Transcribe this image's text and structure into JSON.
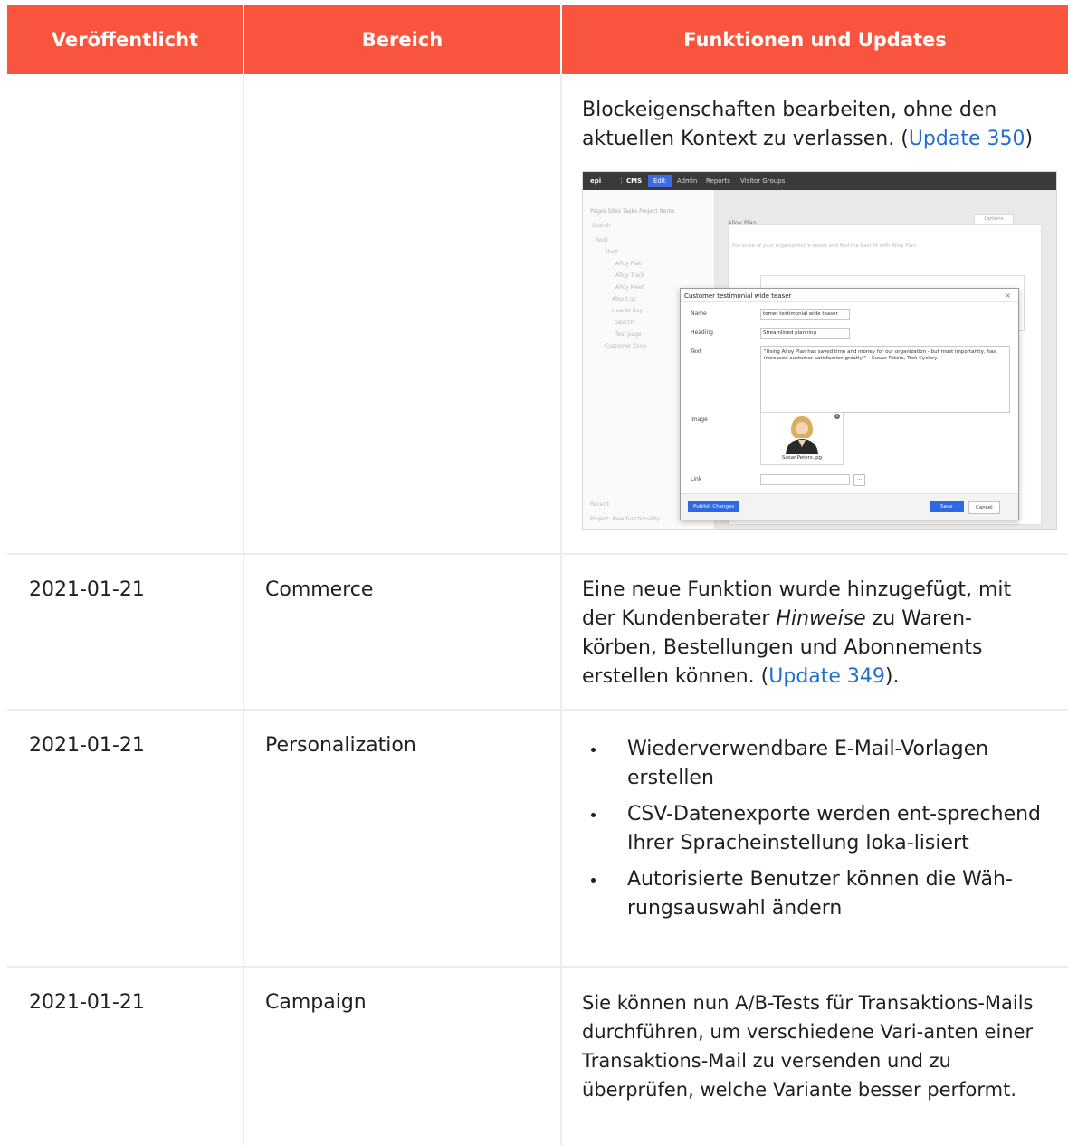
{
  "headers": [
    "Veröffentlicht",
    "Bereich",
    "Funktionen und Updates"
  ],
  "row_block": {
    "text": "Blockeigenschaften bearbeiten, ohne den aktuellen Kontext zu verlassen. (",
    "link": "Update 350",
    "after": ")"
  },
  "screenshot": {
    "topnav": [
      "CMS",
      "Edit",
      "Admin",
      "Reports",
      "Visitor Groups"
    ],
    "tree_tabs": "Pages   Sites   Tasks   Project Items",
    "tree_items": [
      "Search",
      "Root",
      "Start",
      "Alloy Plan",
      "Alloy Track",
      "Alloy Meet",
      "About us",
      "How to buy",
      "Search",
      "Test page",
      "Customer Zone"
    ],
    "recent": "Recent",
    "project": "Project: New functionality",
    "page_title": "Alloy Plan",
    "options_label": "Options",
    "page_intro": "the scale of your organization's needs and find the best fit with Alloy Plan.",
    "dialog_title": "Customer testimonial wide teaser",
    "labels": {
      "name": "Name",
      "heading": "Heading",
      "text": "Text",
      "image": "Image",
      "link": "Link"
    },
    "name_value": "tomer testimonial wide teaser",
    "heading_value": "Streamlined planning",
    "text_value": "\"Using Alloy Plan has saved time and money for our organization - but most importantly, has increased customer satisfaction greatly!\" - Susan Peters, Trek Cyclery",
    "image_name": "SusanPeters.jpg",
    "publish_label": "Publish Changes",
    "save_label": "Save",
    "cancel_label": "Cancel"
  },
  "rows": [
    {
      "date": "2021-01-21",
      "area": "Commerce",
      "text_before": "Eine neue Funktion wurde hinzugefügt, mit der Kundenberater ",
      "text_em": "Hinweise",
      "text_after": " zu Waren-körben, Bestellungen und Abonnements erstellen können. (",
      "link": "Update 349",
      "text_end": ")."
    },
    {
      "date": "2021-01-21",
      "area": "Personalization",
      "bullets": [
        "Wiederverwendbare E-Mail-Vorlagen erstellen",
        "CSV-Datenexporte werden ent-sprechend Ihrer Spracheinstellung loka-lisiert",
        "Autorisierte Benutzer können die Wäh-rungsauswahl ändern"
      ]
    },
    {
      "date": "2021-01-21",
      "area": "Campaign",
      "text": "Sie können nun A/B-Tests für Transaktions-Mails durchführen, um verschiedene Vari-anten einer Transaktions-Mail zu versenden und zu überprüfen, welche Variante besser performt."
    }
  ],
  "colors": {
    "header_bg": "#f9553e",
    "link": "#1f6fd1",
    "grid": "#ececec"
  }
}
